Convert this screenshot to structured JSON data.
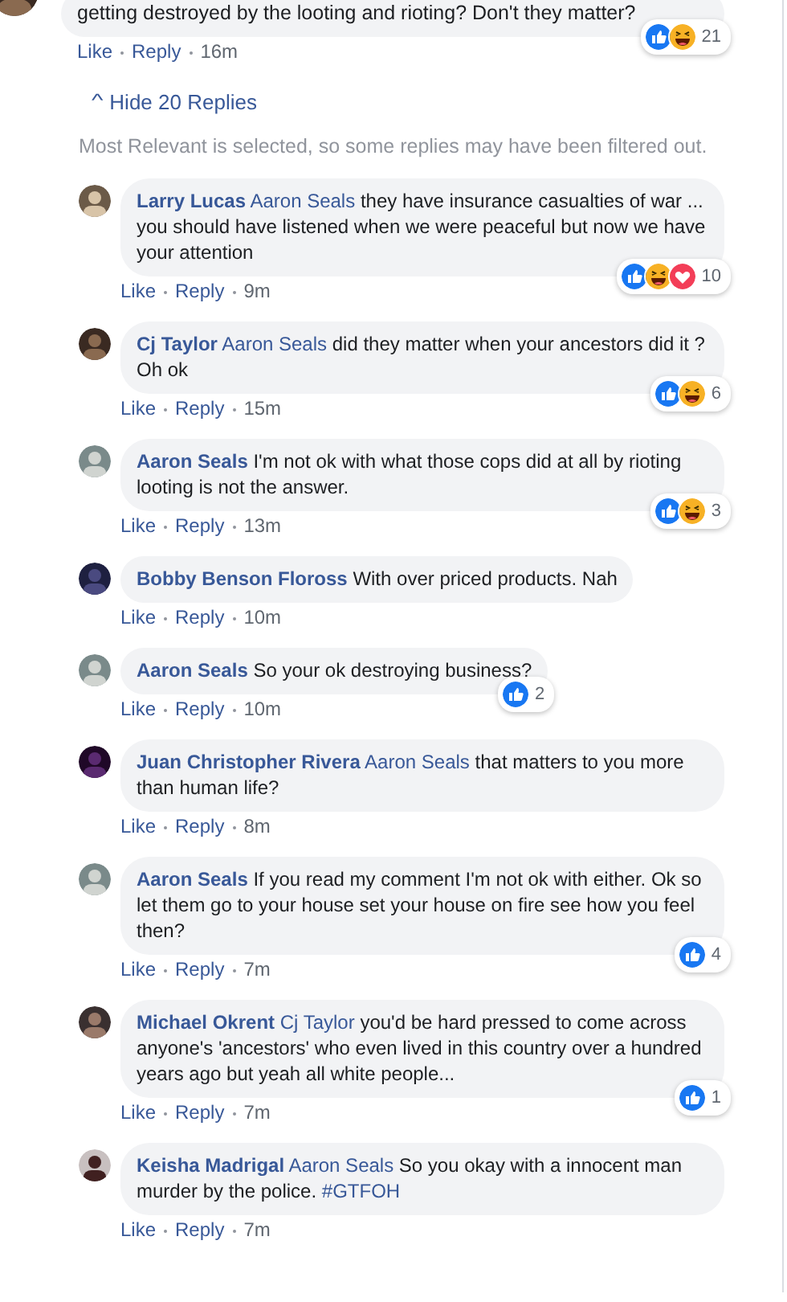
{
  "parent_comment": {
    "text": "getting destroyed by the looting and rioting? Don't they matter?",
    "reactions": [
      {
        "kind": "like"
      },
      {
        "kind": "haha"
      }
    ],
    "reaction_count": "21",
    "like": "Like",
    "reply": "Reply",
    "time": "16m"
  },
  "hide_replies": {
    "chevron": "^",
    "label": "Hide 20 Replies"
  },
  "filter_note": "Most Relevant is selected, so some replies may have been filtered out.",
  "replies": [
    {
      "author": "Larry Lucas",
      "mention": "Aaron Seals",
      "text": "they have insurance casualties of war ... you should have listened when we were peaceful but now we have your attention",
      "reactions": [
        {
          "kind": "like"
        },
        {
          "kind": "haha"
        },
        {
          "kind": "love"
        }
      ],
      "reaction_count": "10",
      "like": "Like",
      "reply": "Reply",
      "time": "9m"
    },
    {
      "author": "Cj Taylor",
      "mention": "Aaron Seals",
      "text": "did they matter when your ancestors did it ? Oh ok",
      "reactions": [
        {
          "kind": "like"
        },
        {
          "kind": "haha"
        }
      ],
      "reaction_count": "6",
      "like": "Like",
      "reply": "Reply",
      "time": "15m"
    },
    {
      "author": "Aaron Seals",
      "text": "I'm not ok with what those cops did at all by rioting looting is not the answer.",
      "reactions": [
        {
          "kind": "like"
        },
        {
          "kind": "haha"
        }
      ],
      "reaction_count": "3",
      "like": "Like",
      "reply": "Reply",
      "time": "13m"
    },
    {
      "author": "Bobby Benson Floross",
      "text": "With over priced products. Nah",
      "like": "Like",
      "reply": "Reply",
      "time": "10m"
    },
    {
      "author": "Aaron Seals",
      "text": "So your ok destroying business?",
      "reactions": [
        {
          "kind": "like"
        }
      ],
      "reaction_count": "2",
      "like": "Like",
      "reply": "Reply",
      "time": "10m"
    },
    {
      "author": "Juan Christopher Rivera",
      "mention": "Aaron Seals",
      "text": "that matters to you more than human life?",
      "like": "Like",
      "reply": "Reply",
      "time": "8m"
    },
    {
      "author": "Aaron Seals",
      "text": "If you read my comment I'm not ok with either. Ok so let them go to your house set your house on fire see how you feel then?",
      "reactions": [
        {
          "kind": "like"
        }
      ],
      "reaction_count": "4",
      "like": "Like",
      "reply": "Reply",
      "time": "7m"
    },
    {
      "author": "Michael Okrent",
      "mention": "Cj Taylor",
      "text": "you'd be hard pressed to come across anyone's 'ancestors' who even lived in this country over a hundred years ago but yeah all white people...",
      "reactions": [
        {
          "kind": "like"
        }
      ],
      "reaction_count": "1",
      "like": "Like",
      "reply": "Reply",
      "time": "7m"
    },
    {
      "author": "Keisha Madrigal",
      "mention": "Aaron Seals",
      "text": "So you okay with a innocent man murder by the police.",
      "hashtag": "#GTFOH",
      "like": "Like",
      "reply": "Reply",
      "time": "7m"
    }
  ]
}
